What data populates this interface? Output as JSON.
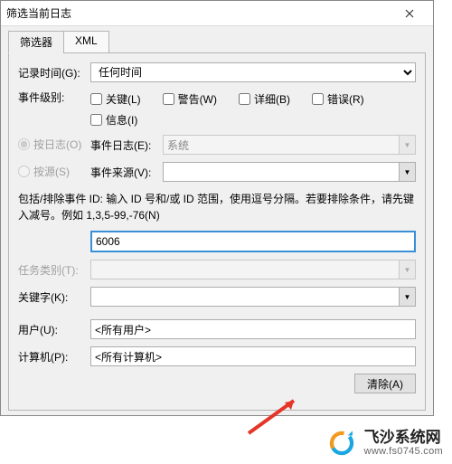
{
  "window": {
    "title": "筛选当前日志"
  },
  "tabs": {
    "filter": "筛选器",
    "xml": "XML"
  },
  "labels": {
    "logged": "记录时间(G):",
    "eventLevel": "事件级别:",
    "byLog": "按日志(O)",
    "bySource": "按源(S)",
    "eventLog": "事件日志(E):",
    "eventSource": "事件来源(V):",
    "taskCategory": "任务类别(T):",
    "keywords": "关键字(K):",
    "user": "用户(U):",
    "computer": "计算机(P):"
  },
  "loggedSelect": {
    "value": "任何时间"
  },
  "levels": {
    "critical": "关键(L)",
    "warning": "警告(W)",
    "verbose": "详细(B)",
    "error": "错误(R)",
    "information": "信息(I)"
  },
  "eventLogValue": "系统",
  "helpText": "包括/排除事件 ID: 输入 ID 号和/或 ID 范围，使用逗号分隔。若要排除条件，请先键入减号。例如 1,3,5-99,-76(N)",
  "eventIdValue": "6006",
  "userValue": "<所有用户>",
  "computerValue": "<所有计算机>",
  "clearBtn": "清除(A)",
  "watermark": {
    "title": "飞沙系统网",
    "url": "www.fs0745.com"
  }
}
